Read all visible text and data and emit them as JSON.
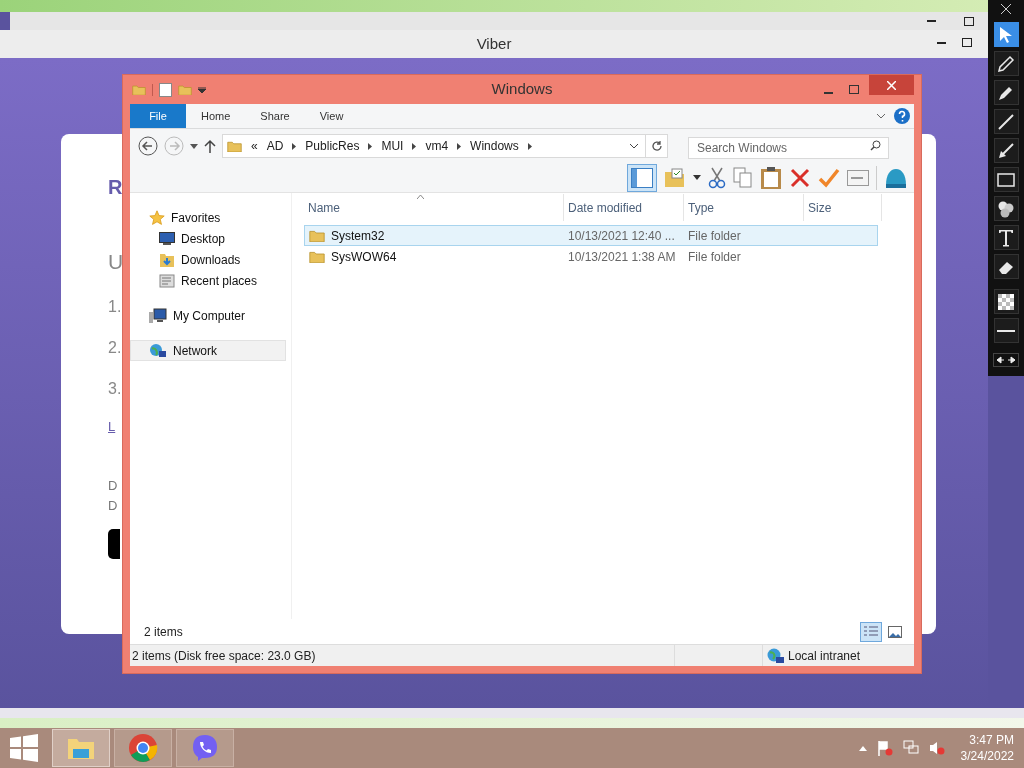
{
  "viber_window": {
    "title": "Viber",
    "page_texts": [
      {
        "kind": "heading",
        "text": "R"
      },
      {
        "kind": "subheading",
        "text": "U"
      },
      {
        "kind": "step",
        "text": "1."
      },
      {
        "kind": "step",
        "text": "2."
      },
      {
        "kind": "step",
        "text": "3."
      },
      {
        "kind": "link",
        "text": "L"
      },
      {
        "kind": "note",
        "text": "D"
      },
      {
        "kind": "note",
        "text": "D"
      }
    ]
  },
  "explorer": {
    "title": "Windows",
    "ribbon_tabs": [
      {
        "label": "File",
        "kind": "file"
      },
      {
        "label": "Home",
        "kind": "tab"
      },
      {
        "label": "Share",
        "kind": "tab"
      },
      {
        "label": "View",
        "kind": "tab"
      }
    ],
    "address": {
      "overflow": "«",
      "path": [
        "AD",
        "PublicRes",
        "MUI",
        "vm4",
        "Windows"
      ]
    },
    "search": {
      "placeholder": "Search Windows"
    },
    "nav": [
      {
        "label": "Favorites",
        "kind": "star",
        "selected": false,
        "children": [
          {
            "label": "Desktop",
            "kind": "desktop",
            "selected": false
          },
          {
            "label": "Downloads",
            "kind": "downloads",
            "selected": false
          },
          {
            "label": "Recent places",
            "kind": "recent",
            "selected": false
          }
        ]
      },
      {
        "label": "My Computer",
        "kind": "computer",
        "selected": false
      },
      {
        "label": "Network",
        "kind": "network",
        "selected": true
      }
    ],
    "columns": [
      "Name",
      "Date modified",
      "Type",
      "Size"
    ],
    "rows": [
      {
        "name": "System32",
        "date": "10/13/2021 12:40 ...",
        "type": "File folder",
        "selected": true
      },
      {
        "name": "SysWOW64",
        "date": "10/13/2021 1:38 AM",
        "type": "File folder",
        "selected": false
      }
    ],
    "item_count": "2 items",
    "views": [
      {
        "kind": "details",
        "selected": true
      },
      {
        "kind": "large",
        "selected": false
      }
    ],
    "status": "2 items (Disk free space: 23.0 GB)",
    "zone": "Local intranet"
  },
  "taskbar": {
    "apps": [
      {
        "kind": "explorer",
        "selected": true
      },
      {
        "kind": "chrome",
        "selected": false
      },
      {
        "kind": "viber",
        "selected": false
      }
    ],
    "time": "3:47 PM",
    "date": "3/24/2022"
  },
  "annotation_tools": [
    {
      "kind": "select",
      "selected": true
    },
    {
      "kind": "pencil",
      "selected": false
    },
    {
      "kind": "marker",
      "selected": false
    },
    {
      "kind": "line",
      "selected": false
    },
    {
      "kind": "arrow",
      "selected": false
    },
    {
      "kind": "rectangle",
      "selected": false
    },
    {
      "kind": "numbers",
      "selected": false
    },
    {
      "kind": "text",
      "selected": false
    },
    {
      "kind": "eraser",
      "selected": false
    },
    {
      "kind": "fill",
      "selected": false
    },
    {
      "kind": "width",
      "selected": false
    }
  ]
}
